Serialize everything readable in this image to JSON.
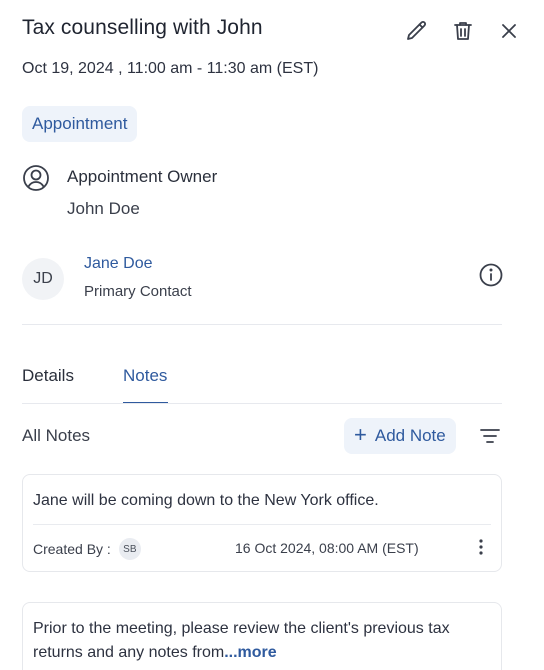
{
  "header": {
    "title": "Tax counselling with John",
    "datetime": "Oct 19, 2024 , 11:00 am - 11:30 am (EST)",
    "actions": [
      "edit-icon",
      "trash-icon",
      "close-icon"
    ]
  },
  "badge": {
    "label": "Appointment"
  },
  "owner": {
    "label": "Appointment Owner",
    "name": "John Doe",
    "icon": "user-circle-icon"
  },
  "contact": {
    "initials": "JD",
    "name": "Jane Doe",
    "role": "Primary Contact",
    "icon": "info-icon"
  },
  "tabs": [
    {
      "label": "Details",
      "active": false
    },
    {
      "label": "Notes",
      "active": true
    }
  ],
  "notes_section": {
    "title": "All Notes",
    "add_label": "Add Note",
    "filter_icon": "filter-icon"
  },
  "notes": [
    {
      "text": "Jane will be coming down to the New York office.",
      "created_by_label": "Created By :",
      "author_initials": "SB",
      "date": "16 Oct 2024, 08:00 AM (EST)"
    },
    {
      "text": "Prior to the meeting, please review the client's previous tax returns and any notes from",
      "more_label": "...more"
    }
  ],
  "colors": {
    "accent": "#2f5a9e",
    "badge_bg": "#eef3fa",
    "text": "#1f2430",
    "divider": "#e7e9ee"
  }
}
